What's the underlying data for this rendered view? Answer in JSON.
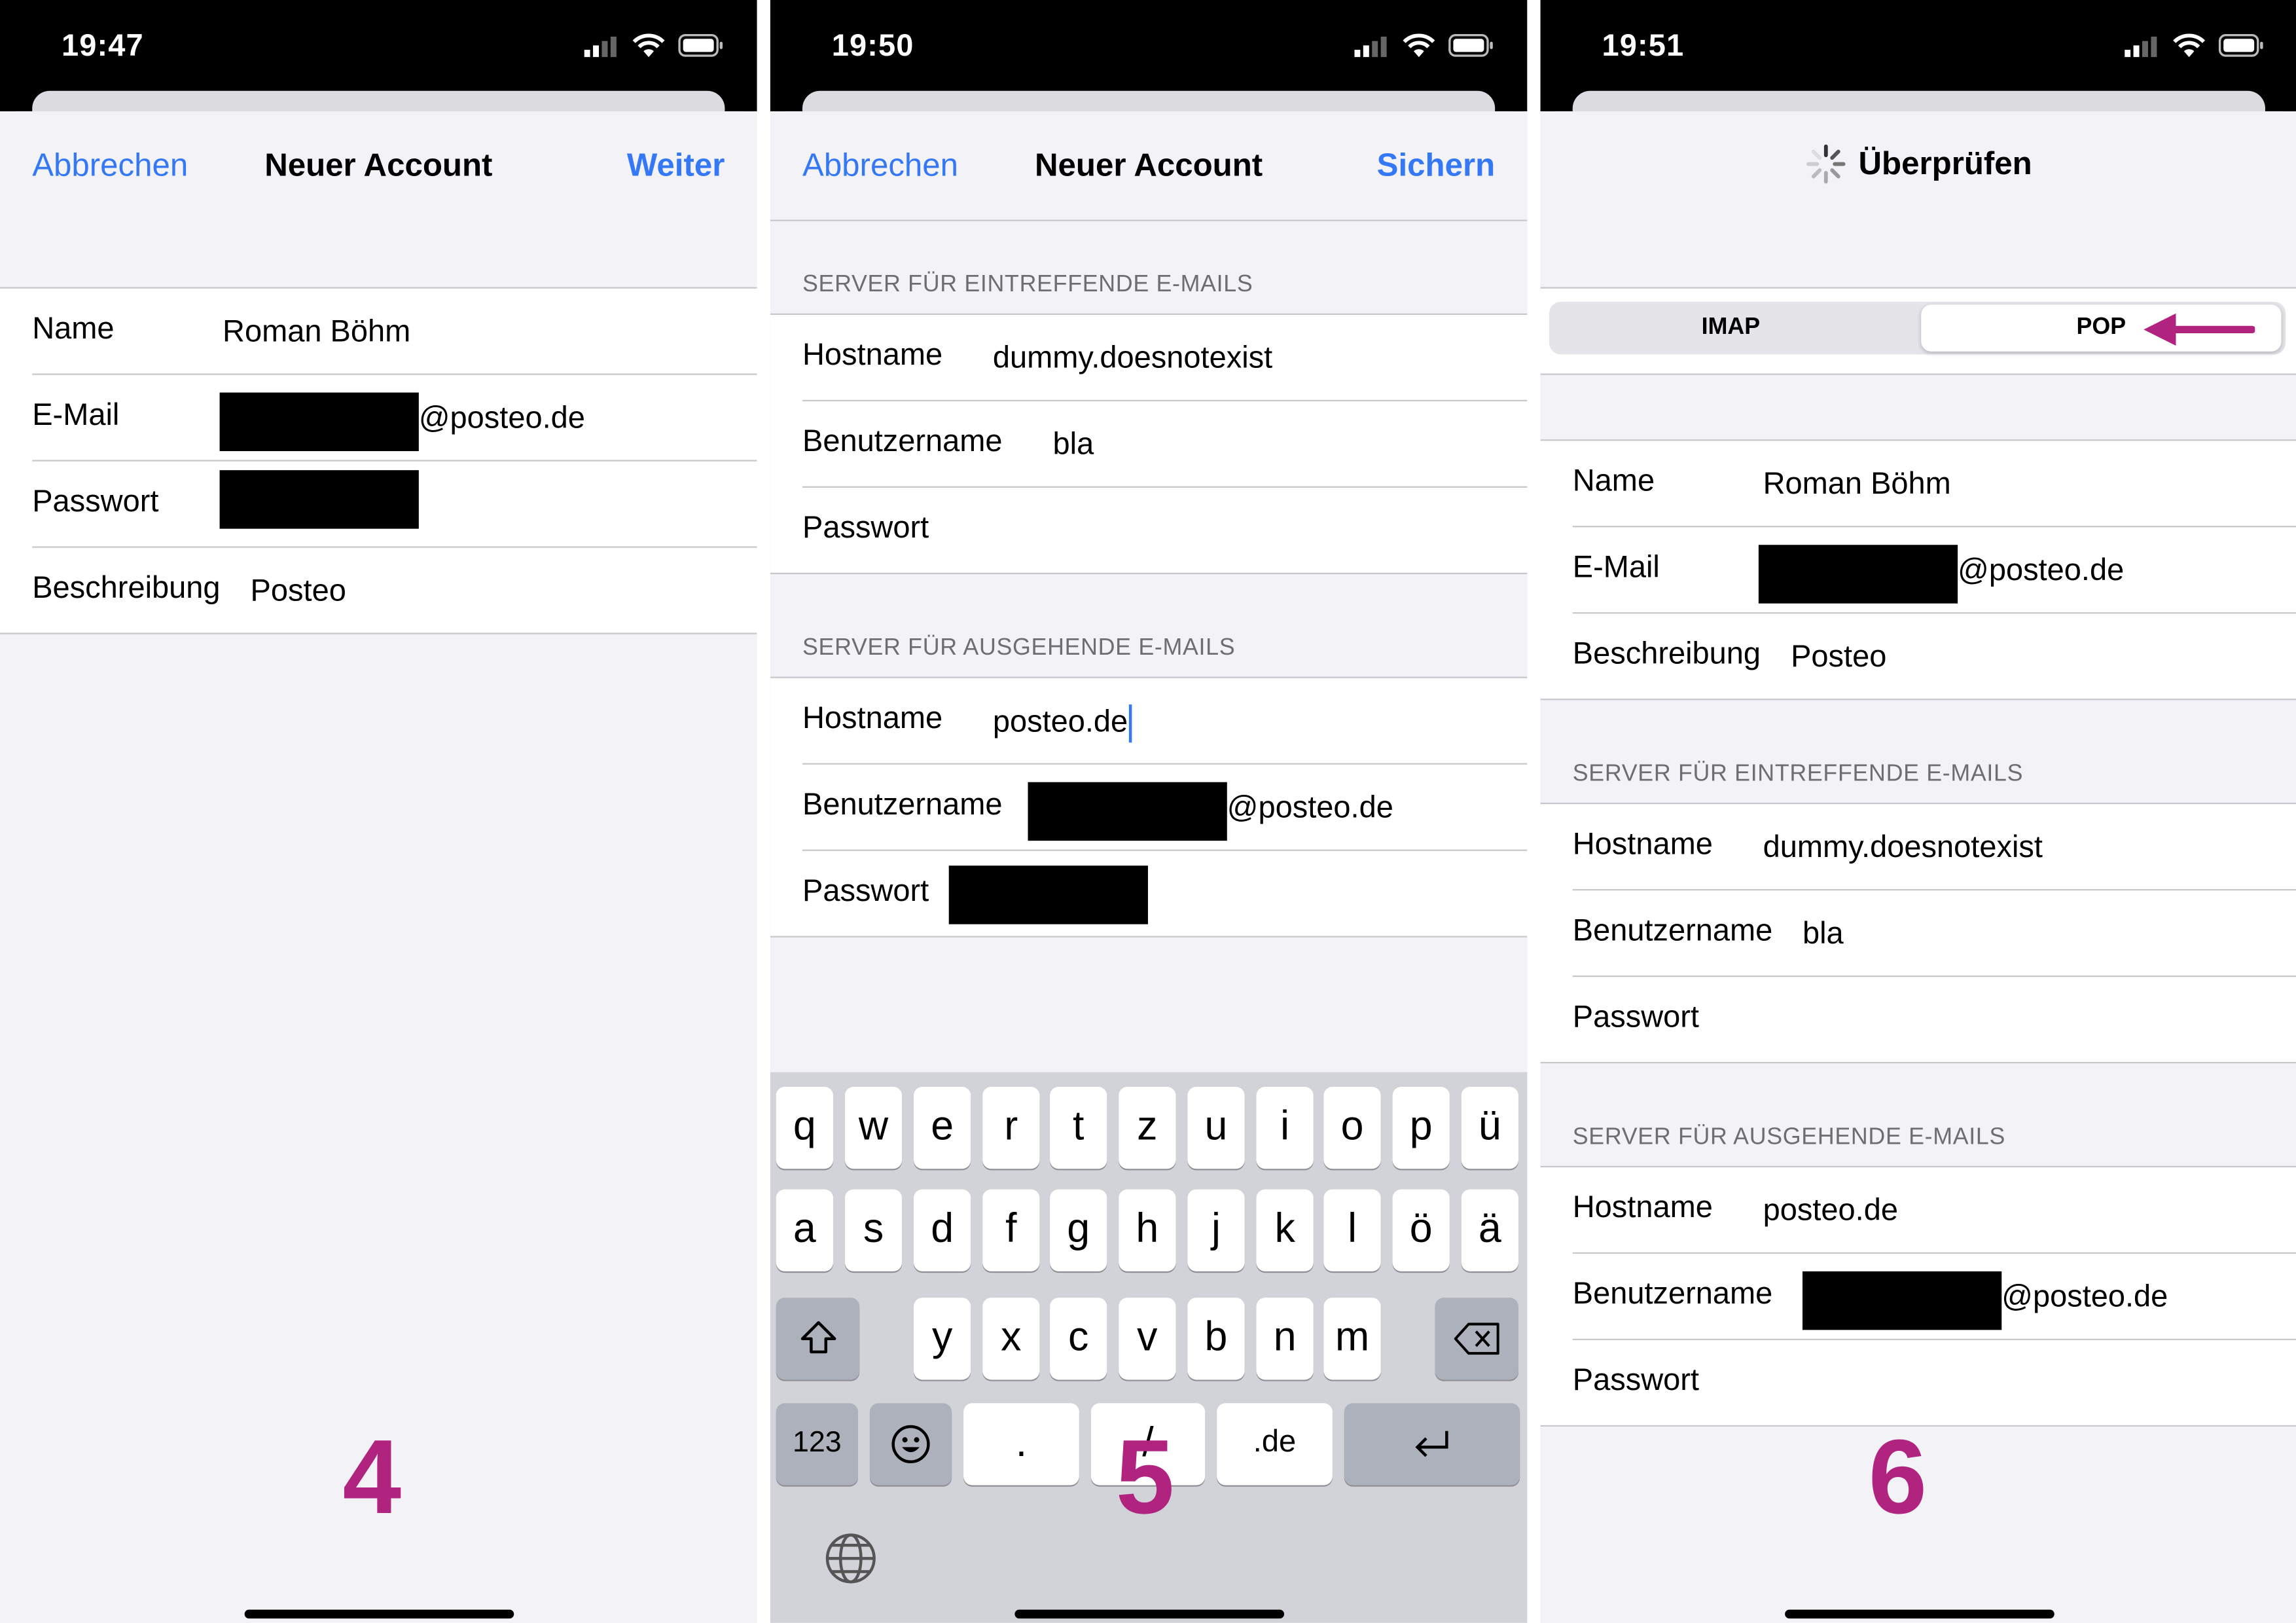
{
  "status_times": [
    "19:47",
    "19:50",
    "19:51"
  ],
  "step_numbers": [
    "4",
    "5",
    "6"
  ],
  "accent_color": "#3478f6",
  "annotation_color": "#b0237f",
  "panel1": {
    "cancel": "Abbrechen",
    "title": "Neuer Account",
    "next": "Weiter",
    "name_label": "Name",
    "name_value": "Roman Böhm",
    "email_label": "E-Mail",
    "email_suffix": "@posteo.de",
    "password_label": "Passwort",
    "description_label": "Beschreibung",
    "description_value": "Posteo"
  },
  "panel2": {
    "cancel": "Abbrechen",
    "title": "Neuer Account",
    "save": "Sichern",
    "incoming_header": "SERVER FÜR EINTREFFENDE E-MAILS",
    "outgoing_header": "SERVER FÜR AUSGEHENDE E-MAILS",
    "hostname_label": "Hostname",
    "username_label": "Benutzername",
    "password_label": "Passwort",
    "incoming_host": "dummy.doesnotexist",
    "incoming_user": "bla",
    "outgoing_host": "posteo.de",
    "outgoing_user_suffix": "@posteo.de",
    "keyboard": {
      "row1": [
        "q",
        "w",
        "e",
        "r",
        "t",
        "z",
        "u",
        "i",
        "o",
        "p",
        "ü"
      ],
      "row2": [
        "a",
        "s",
        "d",
        "f",
        "g",
        "h",
        "j",
        "k",
        "l",
        "ö",
        "ä"
      ],
      "row3": [
        "y",
        "x",
        "c",
        "v",
        "b",
        "n",
        "m"
      ],
      "numbers_key": "123",
      "period_key": ".",
      "slash_key": "/",
      "tld_key": ".de"
    }
  },
  "panel3": {
    "title": "Überprüfen",
    "seg_imap": "IMAP",
    "seg_pop": "POP",
    "name_label": "Name",
    "name_value": "Roman Böhm",
    "email_label": "E-Mail",
    "email_suffix": "@posteo.de",
    "description_label": "Beschreibung",
    "description_value": "Posteo",
    "incoming_header": "SERVER FÜR EINTREFFENDE E-MAILS",
    "outgoing_header": "SERVER FÜR AUSGEHENDE E-MAILS",
    "hostname_label": "Hostname",
    "username_label": "Benutzername",
    "password_label": "Passwort",
    "incoming_host": "dummy.doesnotexist",
    "incoming_user": "bla",
    "outgoing_host": "posteo.de",
    "outgoing_user_suffix": "@posteo.de"
  }
}
